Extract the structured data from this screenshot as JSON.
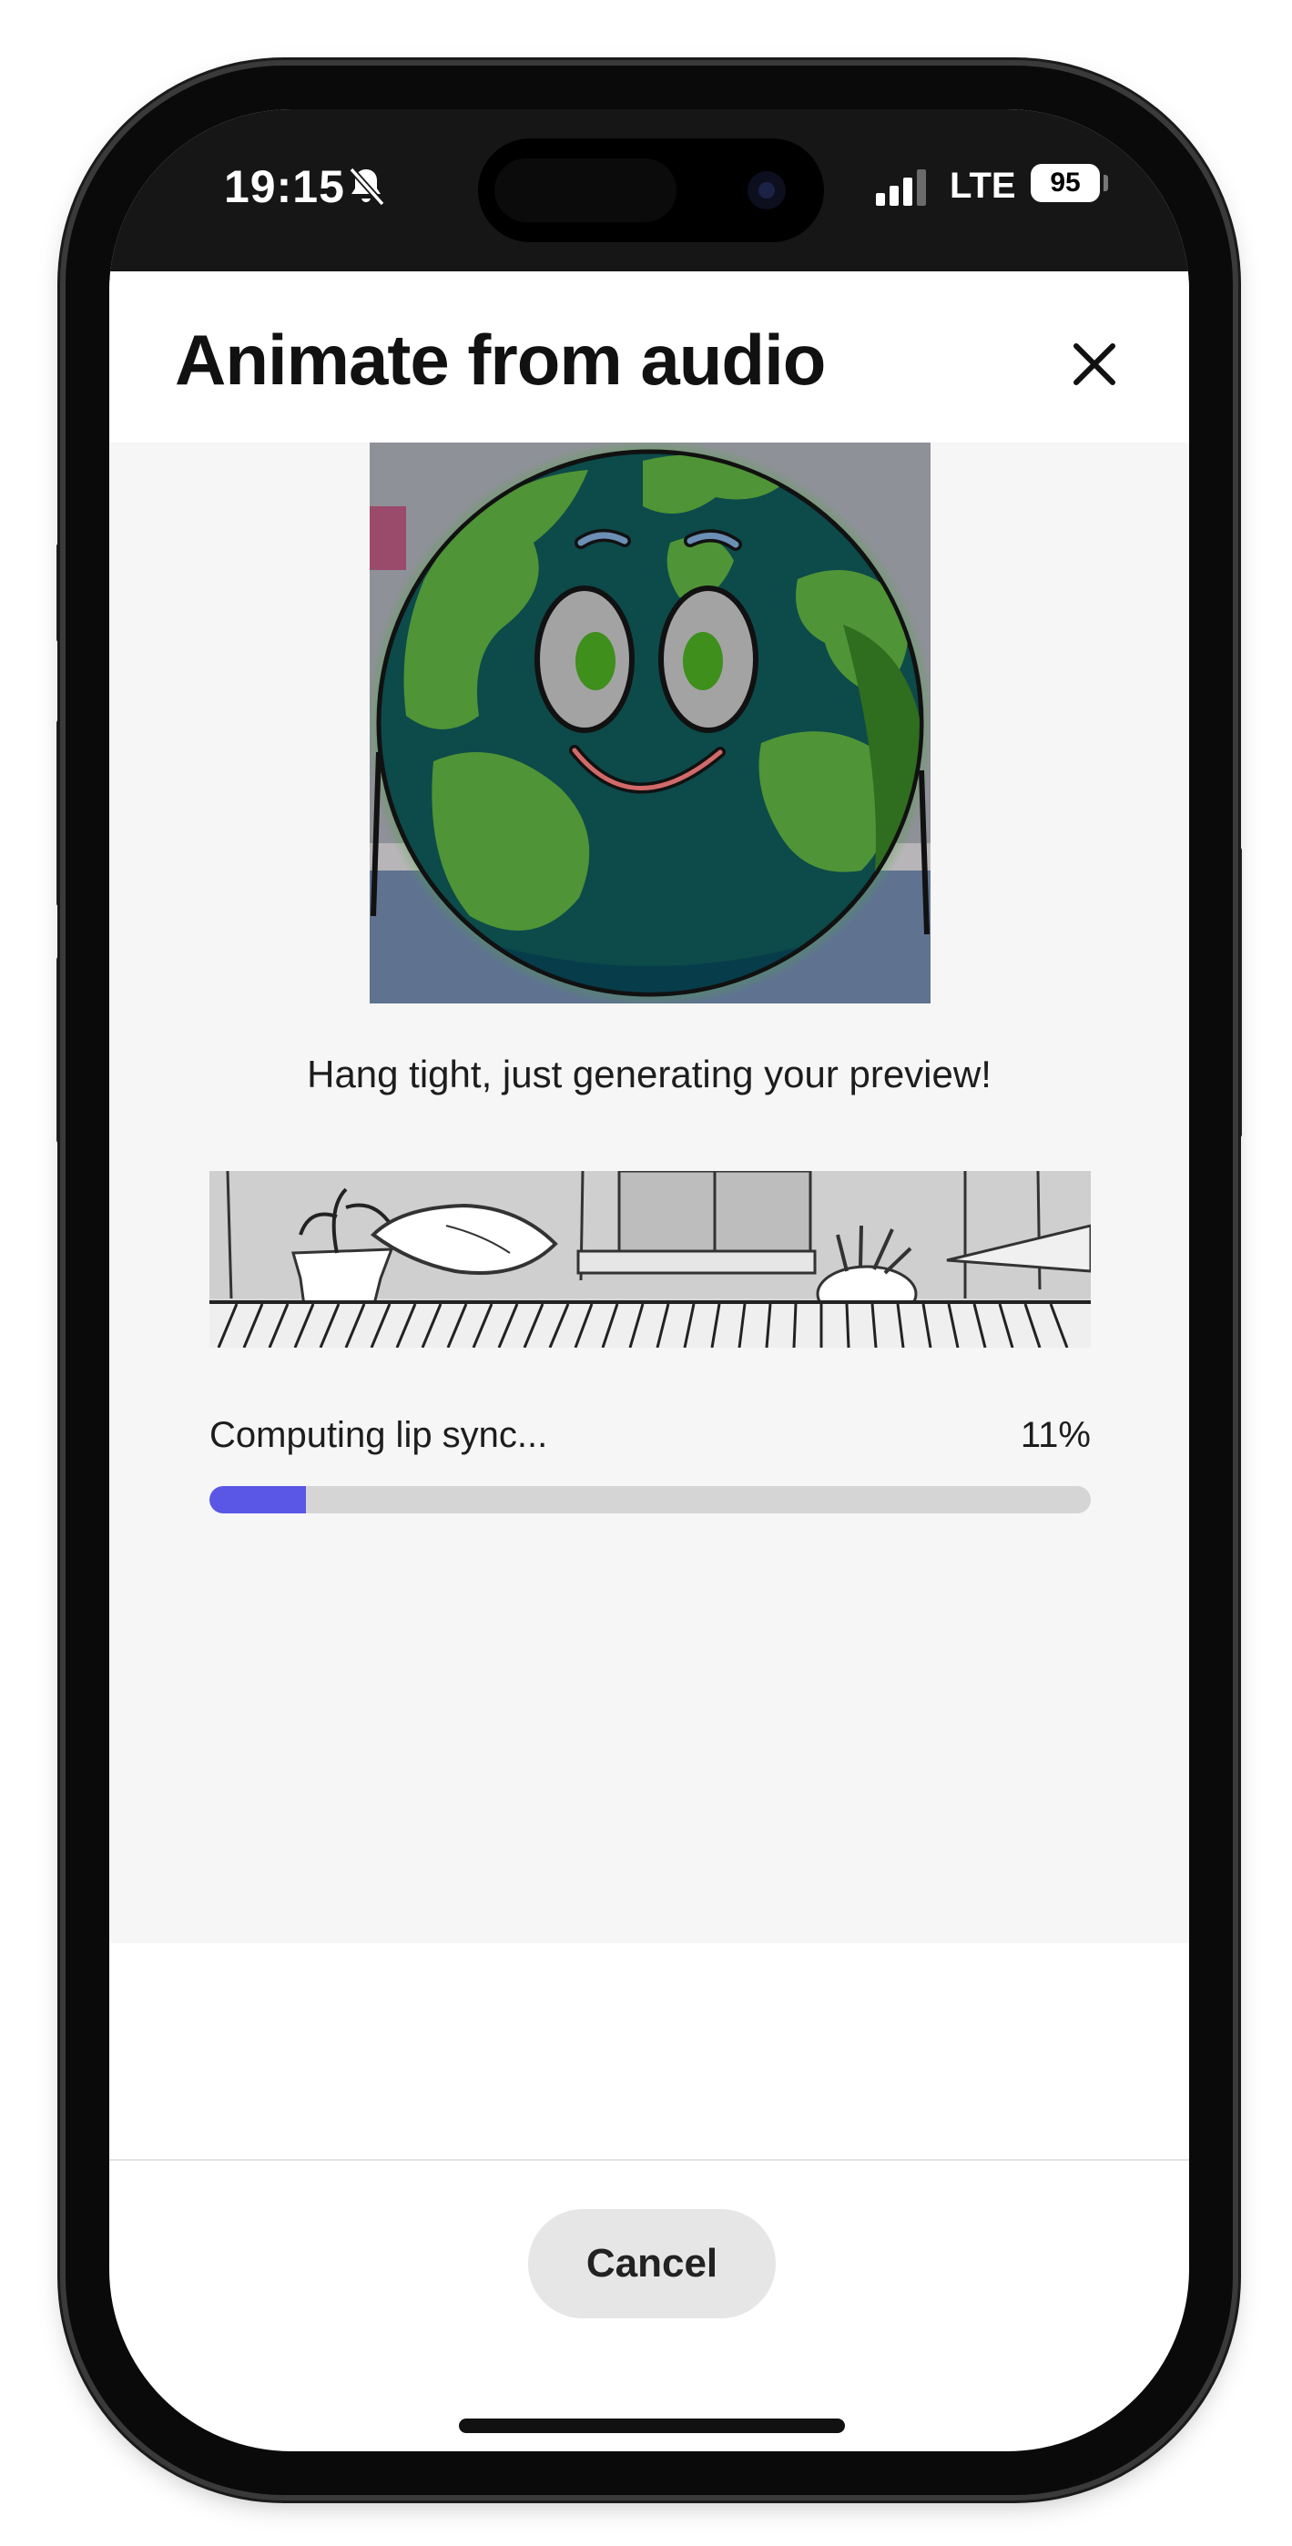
{
  "status_bar": {
    "time": "19:15",
    "silent_icon": "bell-slash-icon",
    "network": "LTE",
    "battery": "95"
  },
  "header": {
    "title": "Animate from audio",
    "close_icon": "close-icon"
  },
  "main": {
    "status_message": "Hang tight, just generating your preview!",
    "progress": {
      "label": "Computing lip sync...",
      "percent_text": "11%",
      "value": 0.11
    }
  },
  "footer": {
    "cancel_label": "Cancel"
  },
  "colors": {
    "accent": "#5a57e6",
    "track": "#d5d5d5",
    "content_bg": "#f6f6f6"
  }
}
